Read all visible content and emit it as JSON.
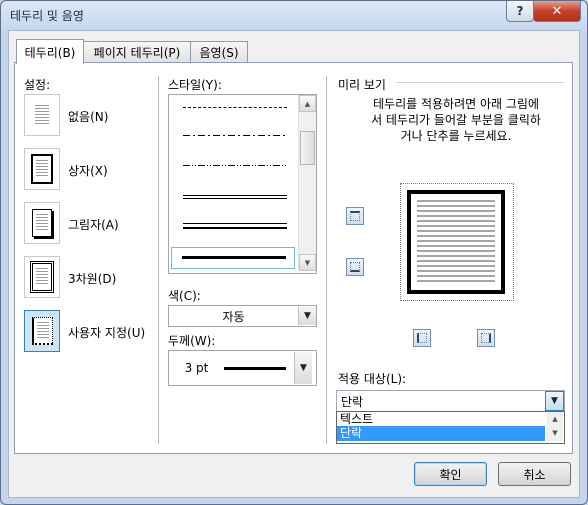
{
  "window": {
    "title": "테두리 및 음영",
    "help_label": "?",
    "close_label": "✕"
  },
  "tabs": [
    {
      "label": "테두리(B)",
      "active": true
    },
    {
      "label": "페이지 테두리(P)",
      "active": false
    },
    {
      "label": "음영(S)",
      "active": false
    }
  ],
  "settings": {
    "label": "설정:",
    "items": [
      {
        "label": "없음(N)",
        "icon": "page-none-icon"
      },
      {
        "label": "상자(X)",
        "icon": "page-box-icon"
      },
      {
        "label": "그림자(A)",
        "icon": "page-shadow-icon"
      },
      {
        "label": "3차원(D)",
        "icon": "page-3d-icon"
      },
      {
        "label": "사용자 지정(U)",
        "icon": "page-custom-icon",
        "selected": true
      }
    ]
  },
  "style": {
    "label": "스타일(Y):",
    "items": [
      "dashed",
      "dash-dot",
      "dash-dot-dot",
      "double",
      "thin-thick",
      "thick"
    ],
    "selected": "thick"
  },
  "color": {
    "label": "색(C):",
    "value": "자동"
  },
  "width": {
    "label": "두께(W):",
    "value": "3 pt"
  },
  "preview": {
    "label": "미리 보기",
    "instructions": "테두리를 적용하려면 아래 그림에서 테두리가 들어갈 부분을 클릭하거나 단추를 누르세요."
  },
  "apply_to": {
    "label": "적용 대상(L):",
    "value": "단락",
    "options": [
      "텍스트",
      "단락"
    ],
    "highlighted": "단락"
  },
  "buttons": {
    "ok": "확인",
    "cancel": "취소"
  },
  "colors": {
    "accent": "#3399ff",
    "selection_bg": "#cde6f7",
    "title_bar": "#c5d6ec",
    "close": "#c4402a"
  }
}
